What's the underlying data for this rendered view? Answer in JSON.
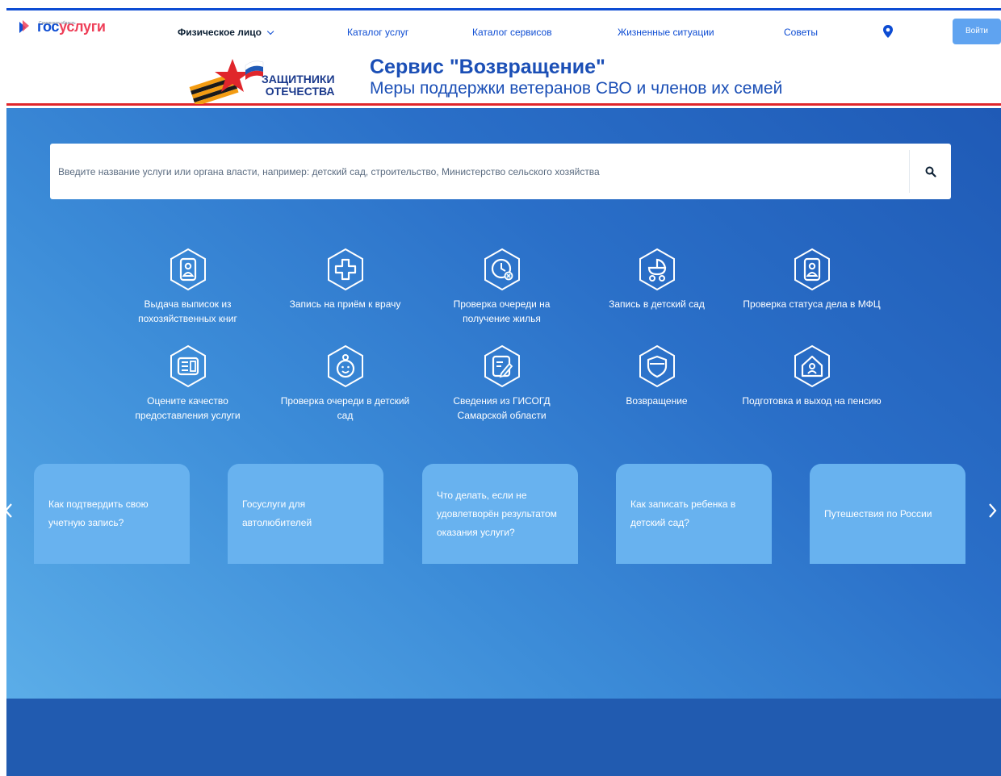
{
  "header": {
    "logo_small": "Самарская область",
    "logo_text_part1": "гос",
    "logo_text_part2": "услуги",
    "nav": {
      "individual": "Физическое лицо",
      "catalog_services": "Каталог услуг",
      "catalog_tools": "Каталог сервисов",
      "life_situations": "Жизненные ситуации",
      "tips": "Советы"
    },
    "login": "Войти"
  },
  "banner": {
    "defenders_line1": "ЗАЩИТНИКИ",
    "defenders_line2": "ОТЕЧЕСТВА",
    "title": "Сервис \"Возвращение\"",
    "subtitle": "Меры поддержки ветеранов СВО и членов их семей"
  },
  "search": {
    "placeholder": "Введите название услуги или органа власти, например: детский сад, строительство, Министерство сельского хозяйства"
  },
  "services": {
    "s1": {
      "label": "Выдача выписок из похозяйственных книг",
      "icon": "id-card-icon"
    },
    "s2": {
      "label": "Запись на приём к врачу",
      "icon": "medical-cross-icon"
    },
    "s3": {
      "label": "Проверка очереди на получение жилья",
      "icon": "clock-icon"
    },
    "s4": {
      "label": "Запись в детский сад",
      "icon": "stroller-icon"
    },
    "s5": {
      "label": "Проверка статуса дела в МФЦ",
      "icon": "id-card-icon"
    },
    "s6": {
      "label": "Оцените качество предоставления услуги",
      "icon": "rating-card-icon"
    },
    "s7": {
      "label": "Проверка очереди в детский сад",
      "icon": "child-icon"
    },
    "s8": {
      "label": "Сведения из ГИСОГД Самарской области",
      "icon": "document-edit-icon"
    },
    "s9": {
      "label": "Возвращение",
      "icon": "shield-icon"
    },
    "s10": {
      "label": "Подготовка и выход на пенсию",
      "icon": "house-person-icon"
    }
  },
  "cards": {
    "c1": "Как подтвердить свою учетную запись?",
    "c2": "Госуслуги для автолюбителей",
    "c3": "Что делать, если не удовлетворён результатом оказания услуги?",
    "c4": "Как записать ребенка в детский сад?",
    "c5": "Путешествия по России"
  },
  "colors": {
    "brand_blue": "#0d4cd3",
    "brand_red": "#ee3f58",
    "hero_gradient_start": "#5bade8",
    "hero_gradient_end": "#1f5ab6",
    "card": "#68b2ef",
    "bottom_band": "#215bb0"
  }
}
